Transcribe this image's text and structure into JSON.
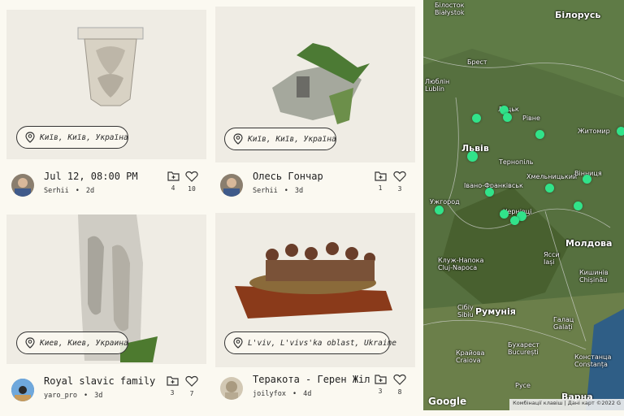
{
  "feed": {
    "cards": [
      {
        "location": "Київ, Київ, Україна",
        "title": "Jul 12, 08:00 PM",
        "user": "Serhii",
        "age": "2d",
        "saves": "4",
        "likes": "10"
      },
      {
        "location": "Київ, Київ, Україна",
        "title": "Олесь Гончар",
        "user": "Serhii",
        "age": "3d",
        "saves": "1",
        "likes": "3"
      },
      {
        "location": "Киев, Киев, Украина",
        "title": "Royal slavic family",
        "user": "yaro_pro",
        "age": "3d",
        "saves": "3",
        "likes": "7"
      },
      {
        "location": "L'viv, L'vivs'ka oblast, Ukraine",
        "title": "Теракота - Герен Жіль",
        "user": "joilyfox",
        "age": "4d",
        "saves": "3",
        "likes": "8"
      }
    ],
    "separator": "•"
  },
  "map": {
    "labels": {
      "bialystok": "Білосток\nBiałystok",
      "belarus": "Білорусь",
      "brest": "Брест",
      "lublin": "Люблін\nLublin",
      "lutsk": "Луцьк",
      "rivne": "Рівне",
      "zhytomyr": "Житомир",
      "lviv": "Львів",
      "ternopil": "Тернопіль",
      "khmelnytskyi": "Хмельницький",
      "vinnytsia": "Вінниця",
      "ivano": "Івано-Франківськ",
      "uzhhorod": "Ужгород",
      "chernivtsi": "Чернівці",
      "moldova": "Молдова",
      "cluj": "Клуж-Напока\nCluj-Napoca",
      "iasi": "Ясси\nIași",
      "chisinau": "Кишинів\nChișinău",
      "romania": "Румунія",
      "sibiu": "Сібіу\nSibiu",
      "galati": "Галац\nGalați",
      "bucharest": "Бухарест\nBucurești",
      "craiova": "Крайова\nCraiova",
      "constanta": "Констанца\nConstanța",
      "ruse": "Русе",
      "varna": "Варна"
    },
    "google": "Google",
    "attribution": "Комбінації клавіш | Дані карт ©2022 G"
  },
  "colors": {
    "pin": "#31e38a",
    "background": "#fbf9f1"
  }
}
